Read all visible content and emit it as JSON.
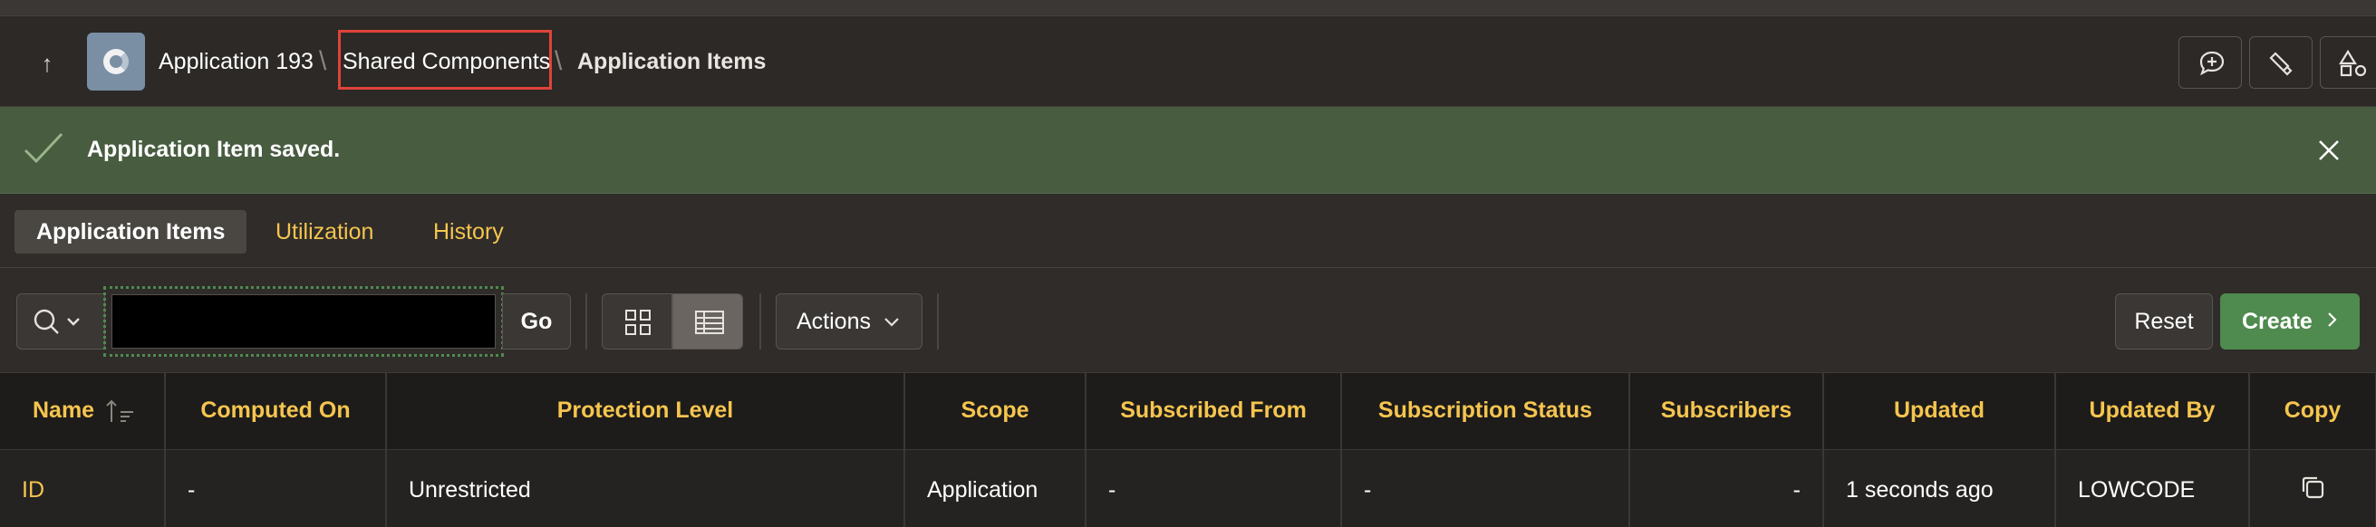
{
  "header": {
    "up_icon": "arrow-up-icon",
    "app_icon": "application-icon",
    "breadcrumb": [
      "Application 193",
      "Shared Components",
      "Application Items"
    ],
    "separator": "\\",
    "actions": [
      "chat-plus-icon",
      "highlighter-icon",
      "shapes-icon"
    ]
  },
  "alert": {
    "message": "Application Item saved.",
    "icon": "check-icon",
    "close_icon": "close-icon",
    "color": "#485c40"
  },
  "tabs": [
    {
      "label": "Application Items",
      "active": true
    },
    {
      "label": "Utilization",
      "active": false
    },
    {
      "label": "History",
      "active": false
    }
  ],
  "toolbar": {
    "search_value": "",
    "go_label": "Go",
    "actions_label": "Actions",
    "reset_label": "Reset",
    "create_label": "Create",
    "accent": "#4f8a4e"
  },
  "table": {
    "columns": [
      "Name",
      "Computed On",
      "Protection Level",
      "Scope",
      "Subscribed From",
      "Subscription Status",
      "Subscribers",
      "Updated",
      "Updated By",
      "Copy"
    ],
    "rows": [
      {
        "name": "ID",
        "computed_on": "-",
        "protection_level": "Unrestricted",
        "scope": "Application",
        "subscribed_from": "-",
        "subscription_status": "-",
        "subscribers": "-",
        "updated": "1 seconds ago",
        "updated_by": "LOWCODE",
        "copy_icon": "copy-icon"
      }
    ],
    "header_color": "#f5c54f"
  }
}
